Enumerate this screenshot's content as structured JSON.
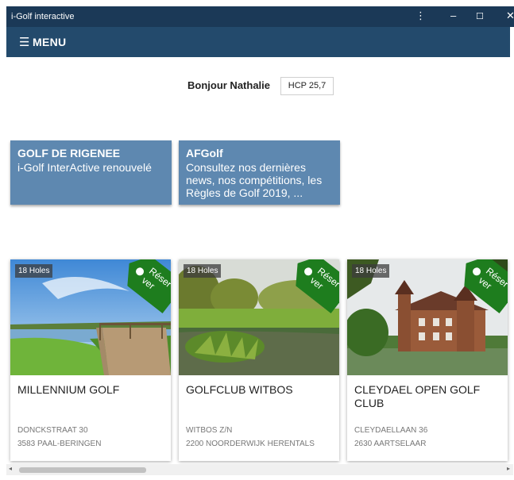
{
  "window": {
    "title": "i-Golf interactive",
    "controls": [
      "⋮",
      "–",
      "☐",
      "✕"
    ]
  },
  "menu": {
    "icon": "hamburger-icon",
    "label": "MENU"
  },
  "user": {
    "greeting": "Bonjour Nathalie",
    "hcp": "HCP 25,7"
  },
  "news": [
    {
      "title": "GOLF DE RIGENEE",
      "text": "i-Golf InterActive renouvelé"
    },
    {
      "title": "AFGolf",
      "text": "Consultez nos dernières news, nos compétitions, les Règles de Golf 2019, ..."
    }
  ],
  "courses": [
    {
      "holes": "18 Holes",
      "tag": "Réser ver",
      "name": "MILLENNIUM GOLF",
      "address1": "DONCKSTRAAT 30",
      "address2": "3583 PAAL-BERINGEN"
    },
    {
      "holes": "18 Holes",
      "tag": "Réser ver",
      "name": "GOLFCLUB WITBOS",
      "address1": "WITBOS Z/N",
      "address2": "2200 NOORDERWIJK HERENTALS"
    },
    {
      "holes": "18 Holes",
      "tag": "Réser ver",
      "name": "CLEYDAEL OPEN GOLF CLUB",
      "address1": "CLEYDAELLAAN 36",
      "address2": "2630 AARTSELAAR"
    }
  ],
  "scrollbar": {
    "left_arrow": "◂",
    "right_arrow": "▸"
  },
  "colors": {
    "titlebar": "#1b3957",
    "menubar": "#234a6c",
    "news_tile": "#5e88b0",
    "tag_green": "#1e7d1e"
  }
}
